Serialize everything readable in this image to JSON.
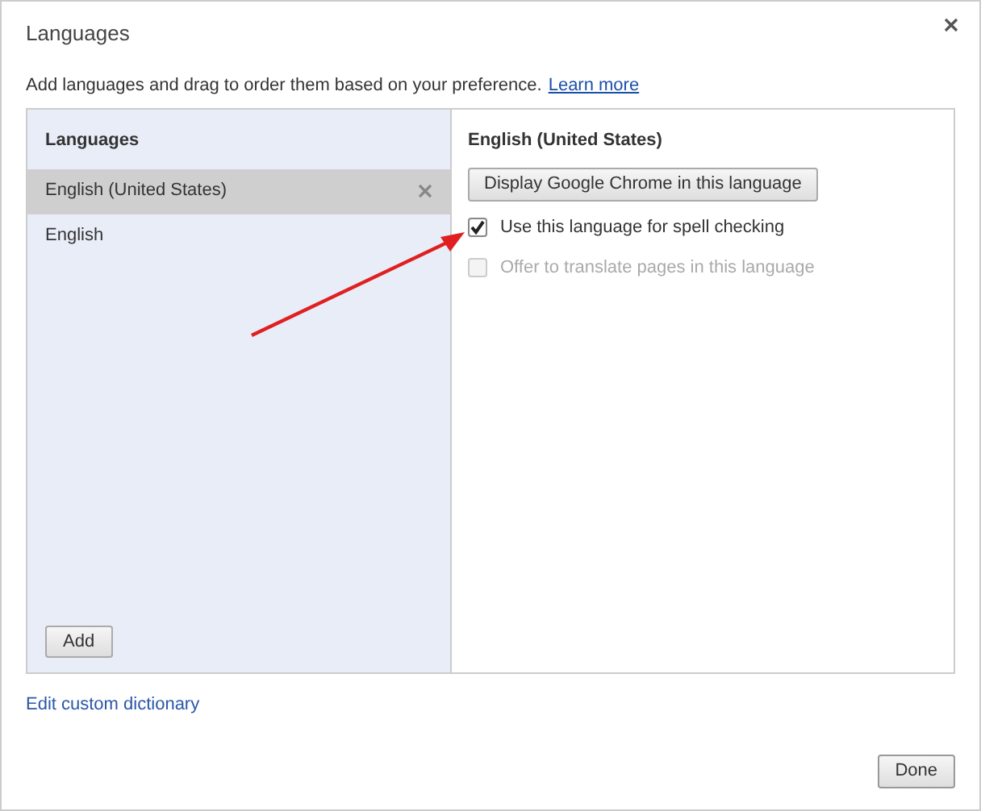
{
  "dialog": {
    "title": "Languages",
    "description": "Add languages and drag to order them based on your preference.",
    "learn_more_link": "Learn more"
  },
  "language_list": {
    "heading": "Languages",
    "items": [
      {
        "label": "English (United States)",
        "selected": true
      },
      {
        "label": "English",
        "selected": false
      }
    ],
    "add_button": "Add"
  },
  "details": {
    "heading": "English (United States)",
    "display_button": "Display Google Chrome in this language",
    "options": [
      {
        "label": "Use this language for spell checking",
        "checked": true,
        "disabled": false
      },
      {
        "label": "Offer to translate pages in this language",
        "checked": false,
        "disabled": true
      }
    ]
  },
  "edit_dictionary_link": "Edit custom dictionary",
  "buttons": {
    "done": "Done"
  }
}
